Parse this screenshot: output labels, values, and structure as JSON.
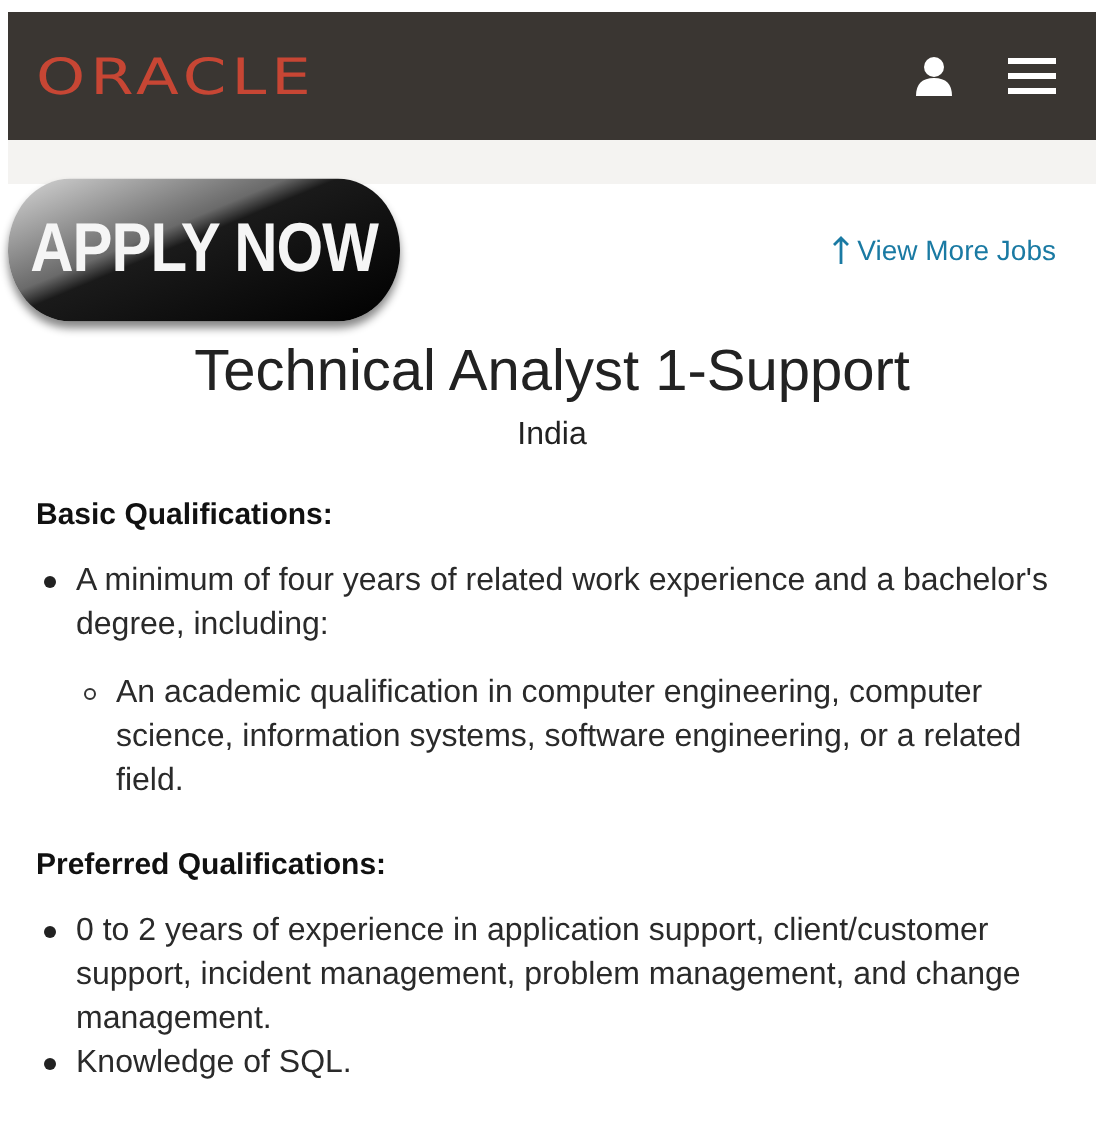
{
  "header": {
    "logo": "ORACLE"
  },
  "apply_button": {
    "label": "APPLY NOW"
  },
  "view_more_link": {
    "label": "View More Jobs"
  },
  "job": {
    "title": "Technical Analyst 1-Support",
    "location": "India"
  },
  "sections": [
    {
      "heading": "Basic Qualifications:",
      "items": [
        {
          "text": "A minimum of four years of related work experience and a bachelor's degree, including:",
          "children": [
            {
              "text": "An academic qualification in computer engineering, computer science, information systems, software engineering, or a related field."
            }
          ]
        }
      ]
    },
    {
      "heading": "Preferred Qualifications:",
      "items": [
        {
          "text": "0 to 2 years of experience in application support, client/customer support, incident management, problem management, and change management."
        },
        {
          "text": "Knowledge of SQL."
        }
      ]
    }
  ]
}
